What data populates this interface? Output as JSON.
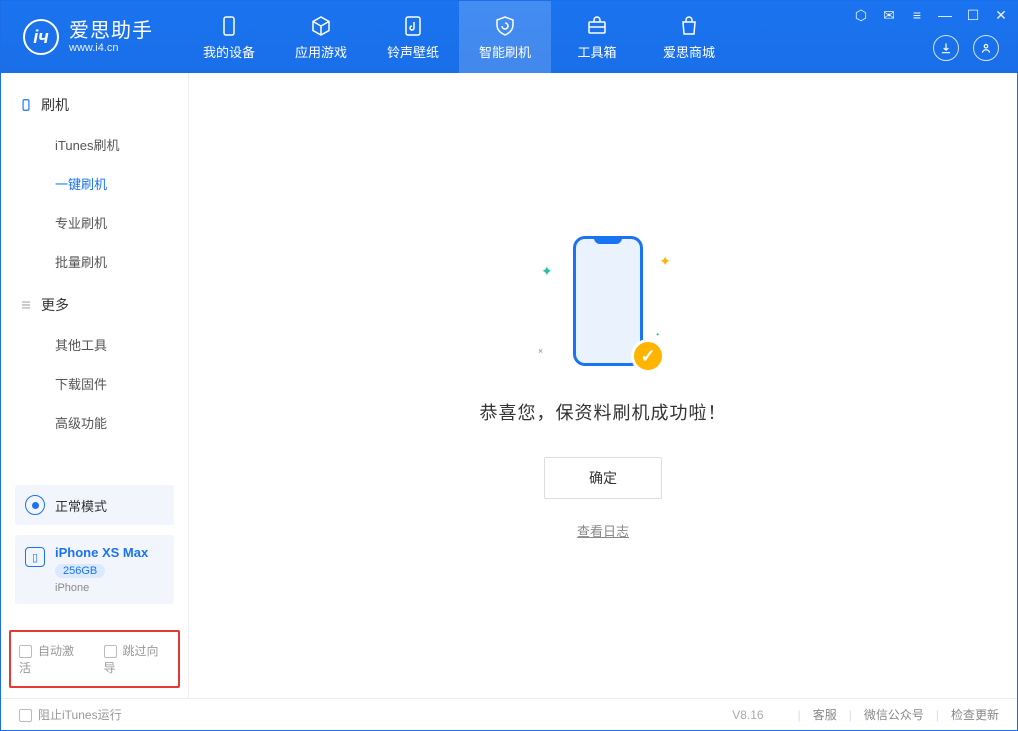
{
  "app": {
    "name_cn": "爱思助手",
    "url": "www.i4.cn"
  },
  "nav": [
    {
      "label": "我的设备"
    },
    {
      "label": "应用游戏"
    },
    {
      "label": "铃声壁纸"
    },
    {
      "label": "智能刷机"
    },
    {
      "label": "工具箱"
    },
    {
      "label": "爱思商城"
    }
  ],
  "active_nav_index": 3,
  "sidebar": {
    "group1": {
      "title": "刷机",
      "items": [
        "iTunes刷机",
        "一键刷机",
        "专业刷机",
        "批量刷机"
      ],
      "active_index": 1
    },
    "group2": {
      "title": "更多",
      "items": [
        "其他工具",
        "下载固件",
        "高级功能"
      ]
    }
  },
  "mode": {
    "label": "正常模式"
  },
  "device": {
    "name": "iPhone XS Max",
    "capacity": "256GB",
    "type": "iPhone"
  },
  "options": {
    "auto_activate": "自动激活",
    "skip_guide": "跳过向导"
  },
  "result": {
    "message": "恭喜您，保资料刷机成功啦！",
    "ok": "确定",
    "view_log": "查看日志"
  },
  "footer": {
    "block_itunes": "阻止iTunes运行",
    "version": "V8.16",
    "links": [
      "客服",
      "微信公众号",
      "检查更新"
    ]
  }
}
